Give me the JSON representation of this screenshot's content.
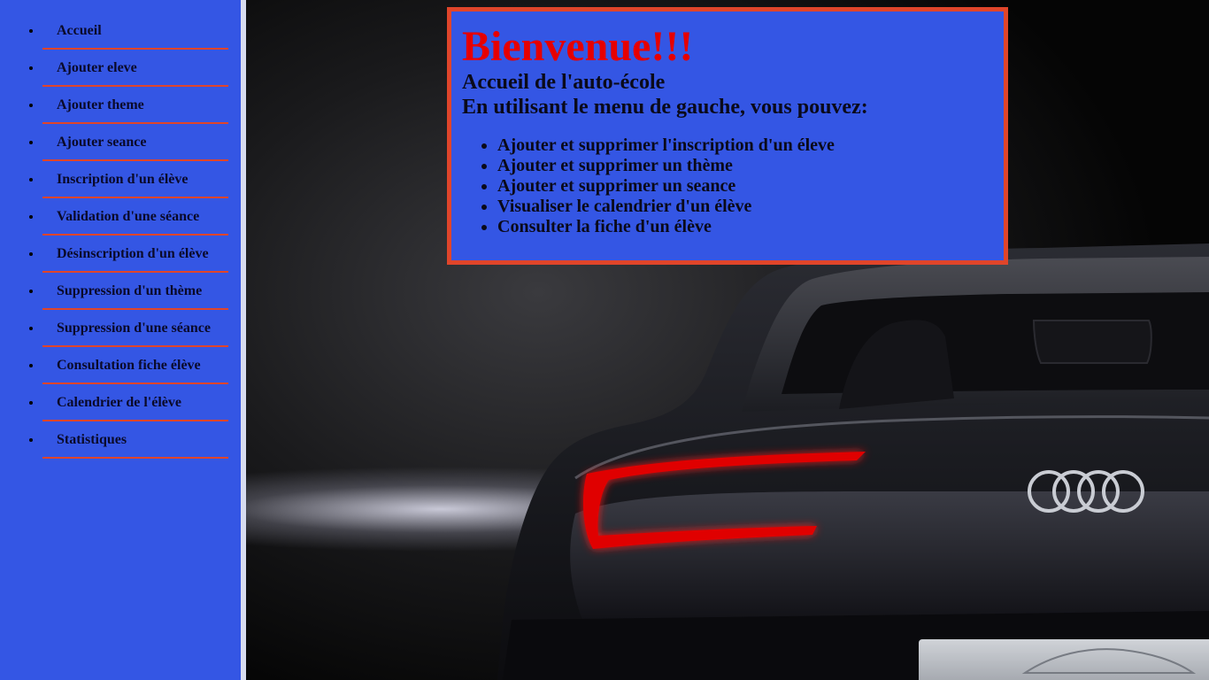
{
  "sidebar": {
    "items": [
      {
        "label": "Accueil"
      },
      {
        "label": "Ajouter eleve"
      },
      {
        "label": "Ajouter theme"
      },
      {
        "label": "Ajouter seance"
      },
      {
        "label": "Inscription d'un élève"
      },
      {
        "label": "Validation d'une séance"
      },
      {
        "label": "Désinscription d'un élève"
      },
      {
        "label": "Suppression d'un thème"
      },
      {
        "label": "Suppression d'une séance"
      },
      {
        "label": "Consultation fiche élève"
      },
      {
        "label": "Calendrier de l'élève"
      },
      {
        "label": "Statistiques"
      }
    ]
  },
  "welcome": {
    "title": "Bienvenue!!!",
    "subtitle": "Accueil de l'auto-école",
    "intro": "En utilisant le menu de gauche, vous pouvez:",
    "features": [
      "Ajouter et supprimer l'inscription d'un éleve",
      "Ajouter et supprimer un thème",
      "Ajouter et supprimer un seance",
      "Visualiser le calendrier d'un élève",
      "Consulter la fiche d'un élève"
    ]
  },
  "colors": {
    "panel_blue": "#3456e4",
    "border_red": "#e0452a",
    "title_red": "#e60000"
  },
  "background": {
    "image": "car-rear-taillight-photo"
  }
}
